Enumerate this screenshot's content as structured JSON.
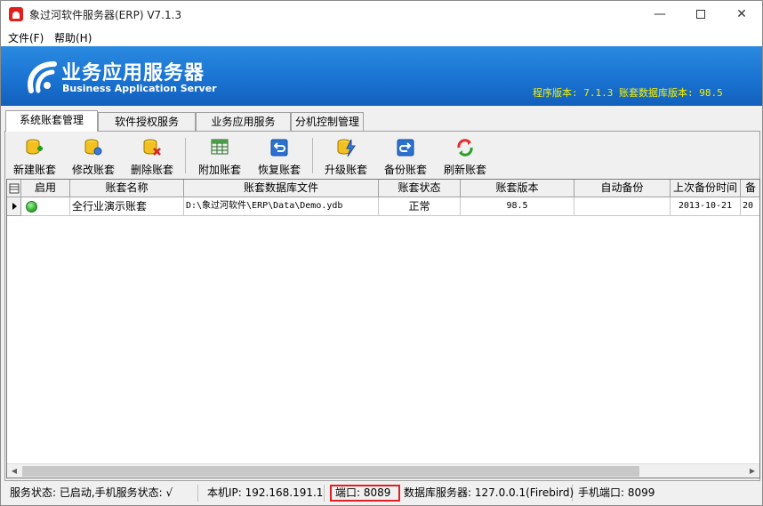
{
  "window": {
    "title": "象过河软件服务器(ERP) V7.1.3",
    "controls": {
      "minimize": "—",
      "close": "✕"
    }
  },
  "menu": {
    "file": "文件(F)",
    "help": "帮助(H)"
  },
  "banner": {
    "title": "业务应用服务器",
    "subtitle": "Business Application Server",
    "version_text": "程序版本: 7.1.3  账套数据库版本: 98.5"
  },
  "tabs": [
    {
      "label": "系统账套管理",
      "active": true
    },
    {
      "label": "软件授权服务",
      "active": false
    },
    {
      "label": "业务应用服务",
      "active": false
    },
    {
      "label": "分机控制管理",
      "active": false
    }
  ],
  "toolbar": {
    "items": [
      {
        "label": "新建账套",
        "icon": "new-db-icon"
      },
      {
        "label": "修改账套",
        "icon": "edit-db-icon"
      },
      {
        "label": "删除账套",
        "icon": "delete-db-icon"
      },
      {
        "label": "附加账套",
        "icon": "attach-grid-icon"
      },
      {
        "label": "恢复账套",
        "icon": "restore-icon"
      },
      {
        "label": "升级账套",
        "icon": "upgrade-icon"
      },
      {
        "label": "备份账套",
        "icon": "backup-icon"
      },
      {
        "label": "刷新账套",
        "icon": "refresh-icon"
      }
    ]
  },
  "grid": {
    "columns": [
      "启用",
      "账套名称",
      "账套数据库文件",
      "账套状态",
      "账套版本",
      "自动备份",
      "上次备份时间",
      "备"
    ],
    "rows": [
      {
        "enabled": true,
        "name": "全行业演示账套",
        "file": "D:\\象过河软件\\ERP\\Data\\Demo.ydb",
        "status": "正常",
        "version": "98.5",
        "auto_backup": "",
        "last_backup": "2013-10-21",
        "extra": "20"
      }
    ]
  },
  "statusbar": {
    "service": "服务状态: 已启动,手机服务状态: √",
    "ip": "本机IP: 192.168.191.1",
    "port": "端口: 8089",
    "db_server": "数据库服务器: 127.0.0.1(Firebird)",
    "mobile_port": "手机端口: 8099"
  },
  "colors": {
    "banner": "#1a73d2",
    "version_text": "#f5f000",
    "highlight": "#e02020"
  }
}
